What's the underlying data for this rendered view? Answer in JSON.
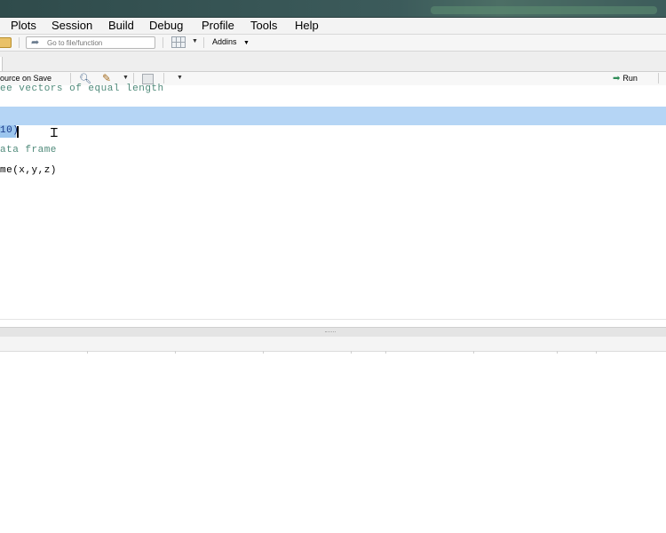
{
  "menu": {
    "items": [
      "Plots",
      "Session",
      "Build",
      "Debug",
      "Profile",
      "Tools",
      "Help"
    ]
  },
  "toolbar": {
    "goto_placeholder": "Go to file/function",
    "addins_label": "Addins"
  },
  "editor_toolbar": {
    "source_on_save_label": "ource on Save",
    "run_label": "Run"
  },
  "editor": {
    "lines": [
      {
        "text": "ee vectors of equal length",
        "type": "comment"
      },
      {
        "text": "10)",
        "type": "code-selected"
      },
      {
        "text": "ata frame",
        "type": "comment"
      },
      {
        "text": "me(x,y,z)",
        "type": "code"
      }
    ]
  },
  "colors": {
    "title_bar": "#3d5a5a",
    "comment": "#4f8a7a",
    "line_highlight": "#b5d5f5",
    "selection": "#9cc6ee"
  }
}
